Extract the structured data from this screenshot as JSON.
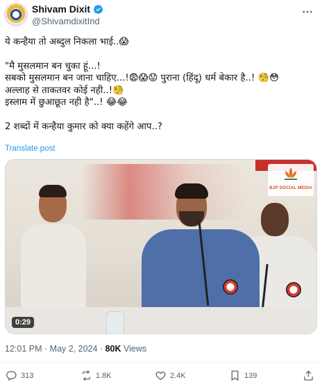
{
  "author": {
    "name": "Shivam Dixit",
    "handle": "@ShivamdixitInd",
    "verified": true
  },
  "tweet": {
    "line1": "ये कन्हैया तो अब्दुल निकला भाई..😱",
    "line2": "\"मै मुसलमान बन चुका हूं...!",
    "line3": "सबको मुसलमान बन जाना चाहिए...!😨😱😟 पुराना (हिंदू) धर्म बेकार है..! 🧐😳",
    "line4": "अल्लाह से ताकतवर कोई नही..!🧐",
    "line5": "इस्लाम में छुआछूत नही है\"..! 😂😂",
    "line6": "2 शब्दों में कन्हैया कुमार को क्या कहेंगे आप..?",
    "translate_label": "Translate post"
  },
  "media": {
    "watermark": "BJP SOCIAL MEDIA",
    "duration": "0:29"
  },
  "meta": {
    "time": "12:01 PM",
    "separator": "·",
    "date": "May 2, 2024",
    "views_count": "80K",
    "views_label": "Views"
  },
  "actions": {
    "replies": "313",
    "reposts": "1.8K",
    "likes": "2.4K",
    "bookmarks": "139"
  },
  "icons": {
    "reply": "reply-icon",
    "repost": "repost-icon",
    "like": "heart-icon",
    "bookmark": "bookmark-icon",
    "share": "share-icon",
    "more": "more-icon"
  },
  "colors": {
    "accent": "#1d9bf0",
    "secondary_text": "#536471"
  }
}
